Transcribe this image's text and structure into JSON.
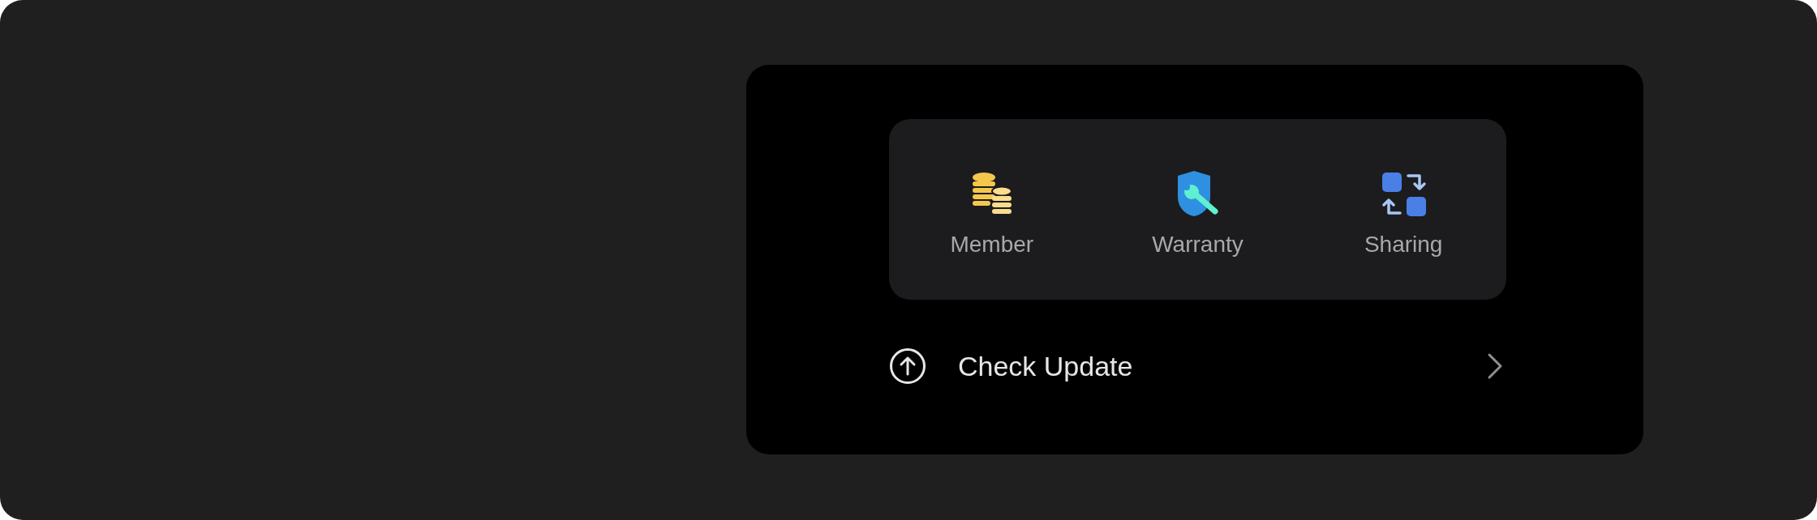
{
  "shortcuts": [
    {
      "kind": "coins",
      "label": "Member"
    },
    {
      "kind": "shield",
      "label": "Warranty"
    },
    {
      "kind": "sharing",
      "label": "Sharing"
    }
  ],
  "menu_items": [
    {
      "kind": "update",
      "label": "Check Update"
    }
  ]
}
